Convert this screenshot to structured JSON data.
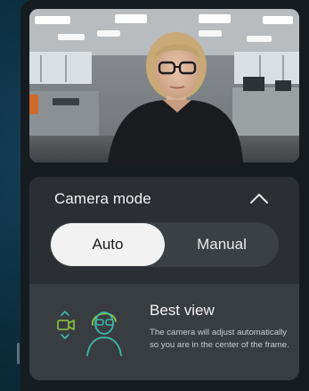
{
  "camera_panel": {
    "title": "Camera mode",
    "collapse_icon": "chevron-up-icon",
    "modes": [
      {
        "label": "Auto",
        "selected": true
      },
      {
        "label": "Manual",
        "selected": false
      }
    ]
  },
  "best_view": {
    "title": "Best view",
    "description": "The camera will adjust automatically so you are in the center of the frame.",
    "icons": [
      "camera-tracking-icon",
      "person-framing-icon"
    ]
  },
  "colors": {
    "accent_teal": "#3fb8a8",
    "accent_green": "#8fc640",
    "panel_bg": "#151b1f",
    "card_bg": "#2b2f33",
    "selected_segment": "#f2f2f2"
  }
}
